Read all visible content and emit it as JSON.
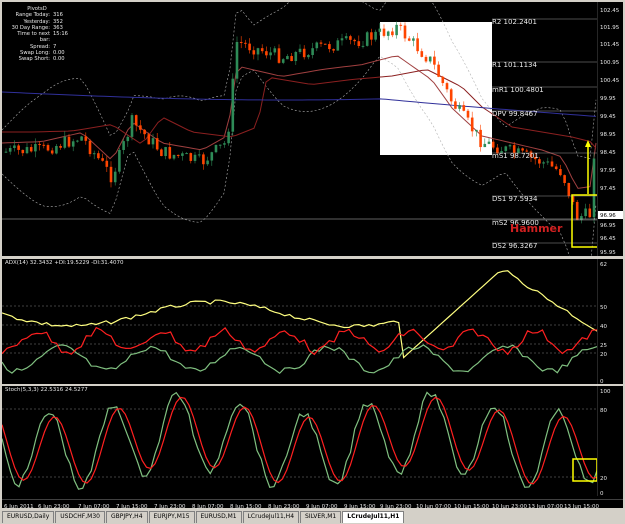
{
  "pivot_panel": {
    "title": "PivotsD",
    "rows": [
      {
        "label": "Range  Today:",
        "value": "316"
      },
      {
        "label": "Yesterday:",
        "value": "352"
      },
      {
        "label": "30 Day Range:",
        "value": "363"
      },
      {
        "label": "Time to next bar:",
        "value": "15:16"
      },
      {
        "label": "Spread:",
        "value": "7"
      },
      {
        "label": "Swap  Long:",
        "value": "0.00"
      },
      {
        "label": "Swap  Short:",
        "value": "0.00"
      }
    ]
  },
  "pivot_levels": [
    {
      "id": "r2",
      "label": "R2  102.2401"
    },
    {
      "id": "r1",
      "label": "R1  101.1134"
    },
    {
      "id": "mr1",
      "label": "mR1  100.4801"
    },
    {
      "id": "dpv",
      "label": "DPV  99.8467"
    },
    {
      "id": "ms1",
      "label": "mS1  98.7201"
    },
    {
      "id": "ds1",
      "label": "DS1  97.5934"
    },
    {
      "id": "ms2",
      "label": "mS2  96.9600"
    },
    {
      "id": "ds2",
      "label": "DS2  96.3267"
    }
  ],
  "annotation": {
    "hammer": "Hammer"
  },
  "price_scale": [
    "102.45",
    "101.95",
    "101.45",
    "100.95",
    "100.45",
    "99.95",
    "99.45",
    "98.95",
    "98.45",
    "97.95",
    "97.45",
    "96.95",
    "96.45",
    "95.95"
  ],
  "current_price": "96.96",
  "adx_title": "ADX(14) 32.3432 +DI:19.5229 -DI:31.4070",
  "adx_scale": [
    "62",
    "50",
    "40",
    "25",
    "20",
    "0"
  ],
  "stoch_title": "Stoch(5,3,3) 22.5316 24.5277",
  "stoch_scale": [
    "100",
    "80",
    "20",
    "0"
  ],
  "time_labels": [
    "6 Jun 2011",
    "6 Jun 23:00",
    "7 Jun 07:00",
    "7 Jun 15:00",
    "7 Jun 23:00",
    "8 Jun 07:00",
    "8 Jun 15:00",
    "8 Jun 23:00",
    "9 Jun 07:00",
    "9 Jun 15:00",
    "9 Jun 23:00",
    "10 Jun 07:00",
    "10 Jun 15:00",
    "10 Jun 23:00",
    "13 Jun 07:00",
    "13 Jun 15:00"
  ],
  "tabs": [
    "EURUSD,Daily",
    "USDCHF,M30",
    "GBPJPY,H4",
    "EURJPY,M15",
    "EURUSD,M1",
    "LCrudeJul11,H4",
    "SILVER,M1",
    "LCrudeJul11,H1"
  ],
  "active_tab": 7,
  "colors": {
    "background": "#000000",
    "bull_candle": "#2e8b57",
    "bear_candle": "#ff4500",
    "adx_line": "#ffff80",
    "plus_di": "#80c080",
    "minus_di": "#ff2020",
    "stoch_main": "#80c080",
    "stoch_signal": "#ff2020",
    "highlight_box": "#ffff00"
  }
}
